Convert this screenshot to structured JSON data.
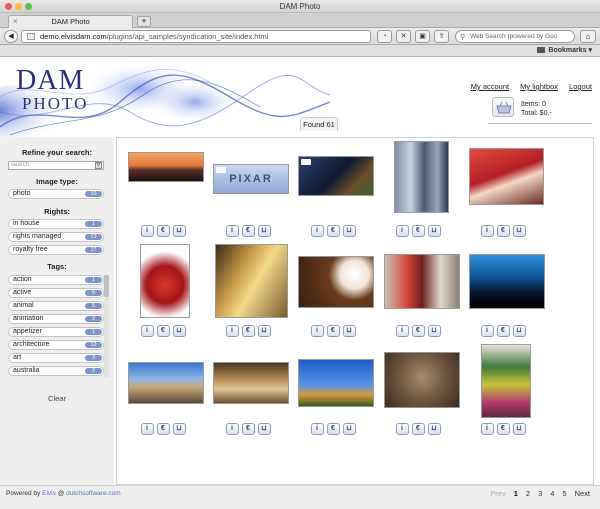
{
  "window": {
    "title": "DAM Photo"
  },
  "browser": {
    "tab_title": "DAM Photo",
    "new_tab": "+",
    "url_host": "demo.elvisdam.com",
    "url_path": "/plugins/api_samples/syndication_site/index.html",
    "search_placeholder": "Web Search (powered by Goo",
    "bookmarks_label": "Bookmarks"
  },
  "header": {
    "logo_top": "DAM",
    "logo_bottom": "PHOTO",
    "links": {
      "account": "My account",
      "lightbox": "My lightbox",
      "logout": "Logout"
    },
    "cart": {
      "items_label": "Items: 0",
      "total_label": "Total: $0,-"
    }
  },
  "results": {
    "found_label": "Found 61"
  },
  "sidebar": {
    "title": "Refine your search:",
    "search_placeholder": "search",
    "image_type": {
      "heading": "Image type:",
      "items": [
        {
          "label": "photo",
          "count": "16"
        }
      ]
    },
    "rights": {
      "heading": "Rights:",
      "items": [
        {
          "label": "in house",
          "count": "1"
        },
        {
          "label": "rights managed",
          "count": "13"
        },
        {
          "label": "royalty free",
          "count": "17"
        }
      ]
    },
    "tags": {
      "heading": "Tags:",
      "items": [
        {
          "label": "action",
          "count": "1"
        },
        {
          "label": "active",
          "count": "5"
        },
        {
          "label": "animal",
          "count": "5"
        },
        {
          "label": "animation",
          "count": "2"
        },
        {
          "label": "appetizer",
          "count": "1"
        },
        {
          "label": "architecture",
          "count": "12"
        },
        {
          "label": "art",
          "count": "3"
        },
        {
          "label": "australia",
          "count": "2"
        }
      ]
    },
    "clear_label": "Clear"
  },
  "action_icons": {
    "info": "i",
    "price": "€",
    "basket": "cart-icon"
  },
  "footer": {
    "powered_prefix": "Powered by",
    "powered_link1": "Elvis",
    "powered_sep": "@",
    "powered_link2": "dutchsoftware.com",
    "prev_label": "Prev",
    "pages": [
      "1",
      "2",
      "3",
      "4",
      "5"
    ],
    "next_label": "Next"
  },
  "thumbnails": {
    "pixar_logo": "PIXAR"
  },
  "colors": {
    "accent": "#7d95c7",
    "logo": "#2b2f7a",
    "link": "#4d6fb0"
  }
}
